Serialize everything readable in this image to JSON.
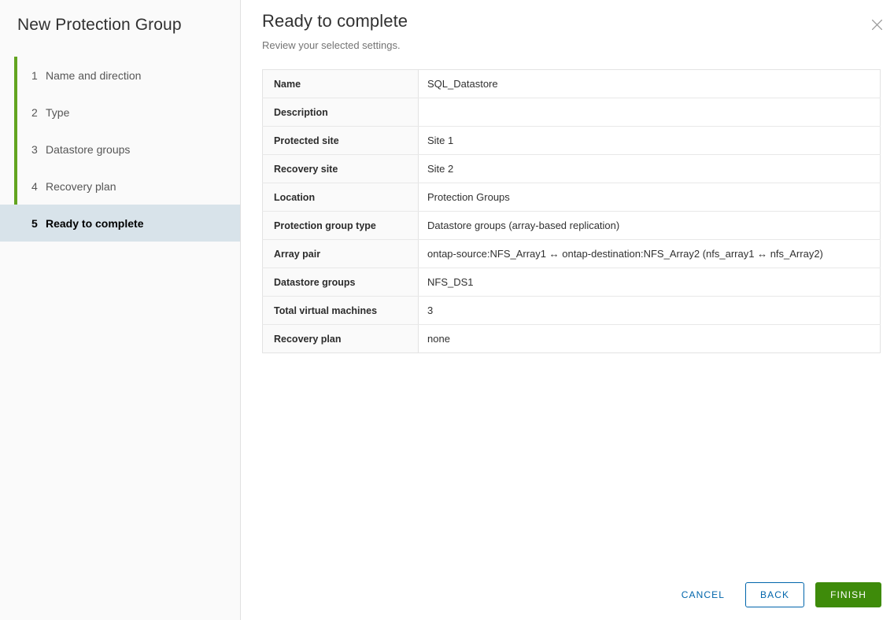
{
  "wizard": {
    "title": "New Protection Group",
    "steps": [
      {
        "num": "1",
        "label": "Name and direction",
        "state": "done"
      },
      {
        "num": "2",
        "label": "Type",
        "state": "done"
      },
      {
        "num": "3",
        "label": "Datastore groups",
        "state": "done"
      },
      {
        "num": "4",
        "label": "Recovery plan",
        "state": "done"
      },
      {
        "num": "5",
        "label": "Ready to complete",
        "state": "active"
      }
    ]
  },
  "page": {
    "title": "Ready to complete",
    "subtitle": "Review your selected settings."
  },
  "close": {
    "icon": "close-icon",
    "label": "Close"
  },
  "summary": {
    "rows": [
      {
        "label": "Name",
        "value": "SQL_Datastore"
      },
      {
        "label": "Description",
        "value": ""
      },
      {
        "label": "Protected site",
        "value": "Site 1"
      },
      {
        "label": "Recovery site",
        "value": "Site 2"
      },
      {
        "label": "Location",
        "value": "Protection Groups"
      },
      {
        "label": "Protection group type",
        "value": "Datastore groups (array-based replication)"
      },
      {
        "label": "Array pair",
        "value": "ontap-source:NFS_Array1 ↔ ontap-destination:NFS_Array2 (nfs_array1 ↔ nfs_Array2)"
      },
      {
        "label": "Datastore groups",
        "value": "NFS_DS1"
      },
      {
        "label": "Total virtual machines",
        "value": "3"
      },
      {
        "label": "Recovery plan",
        "value": "none"
      }
    ]
  },
  "footer": {
    "cancel_label": "CANCEL",
    "back_label": "BACK",
    "finish_label": "FINISH"
  },
  "colors": {
    "progress_done": "#62a420",
    "progress_todo": "#e8e8e8",
    "active_step_bg": "#d8e3ea",
    "link_blue": "#0065ab",
    "finish_green": "#3e8b0a",
    "sidebar_bg": "#fafafa",
    "label_cell_bg": "#fafafa",
    "table_border": "#e3e3e3"
  }
}
